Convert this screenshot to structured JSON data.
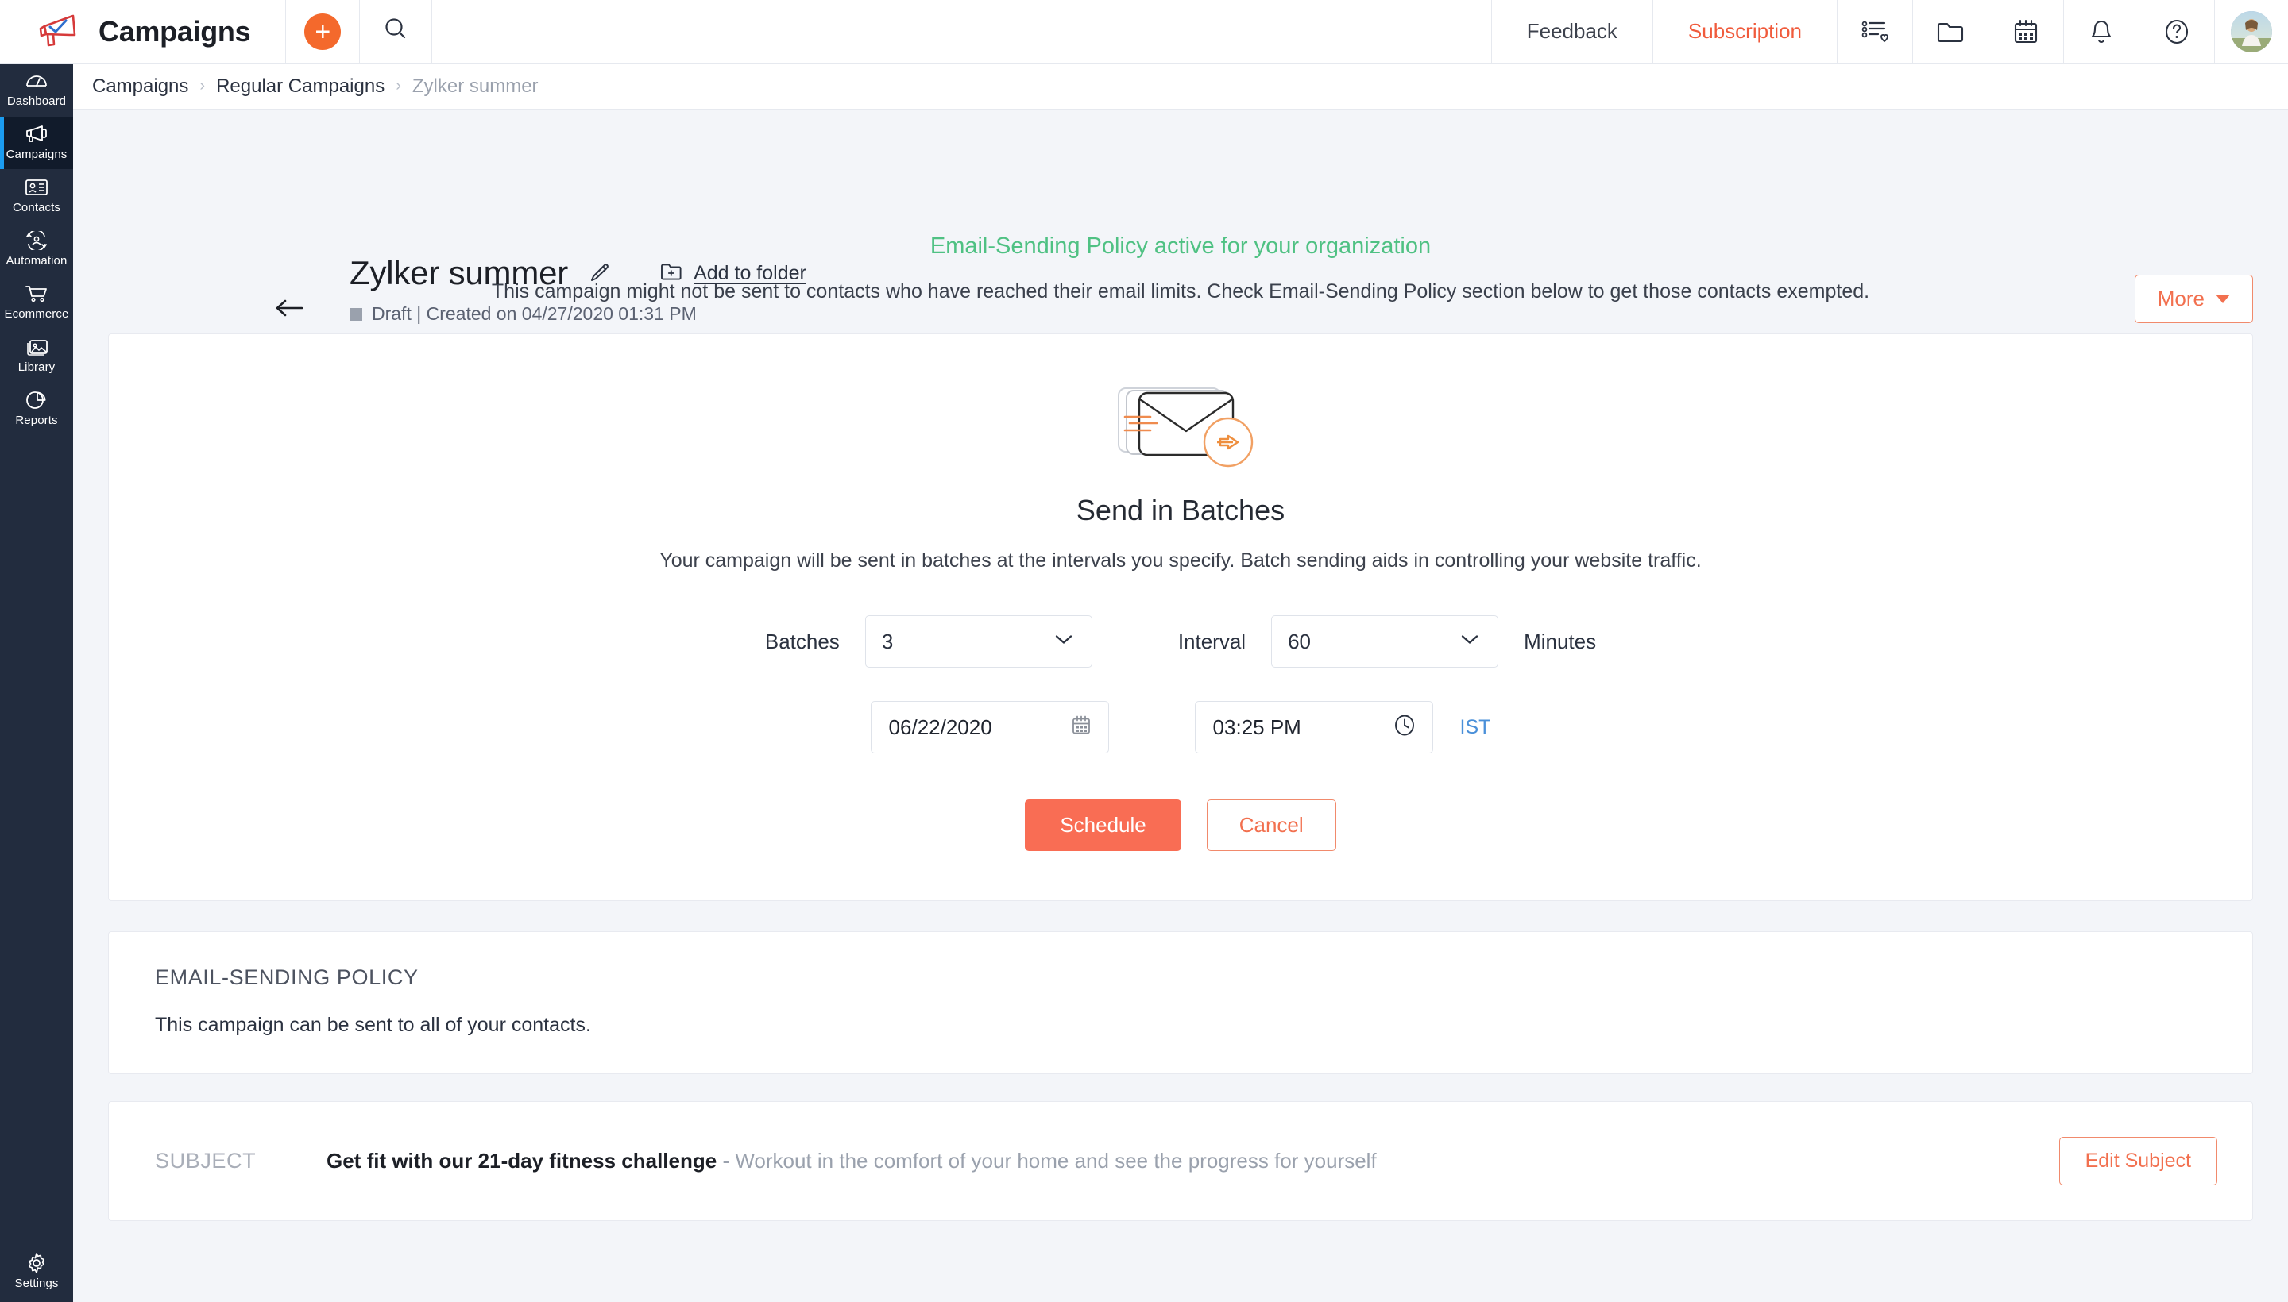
{
  "app": {
    "brand_name": "Campaigns",
    "logo_icon": "megaphone-logo-icon",
    "add_icon": "plus-icon",
    "search_icon": "search-icon"
  },
  "topbar": {
    "feedback_label": "Feedback",
    "subscription_label": "Subscription",
    "subscription_color": "#f05b3c",
    "icons": [
      {
        "name": "list-heart-icon"
      },
      {
        "name": "folder-icon"
      },
      {
        "name": "calendar-icon"
      },
      {
        "name": "bell-icon"
      },
      {
        "name": "help-circle-icon"
      }
    ],
    "avatar_name": "user-avatar"
  },
  "sidebar": {
    "background": "#222c3e",
    "active_accent": "#1b9cf0",
    "items": [
      {
        "label": "Dashboard",
        "icon": "gauge-icon",
        "active": false
      },
      {
        "label": "Campaigns",
        "icon": "megaphone-icon",
        "active": true
      },
      {
        "label": "Contacts",
        "icon": "contact-card-icon",
        "active": false
      },
      {
        "label": "Automation",
        "icon": "automation-users-icon",
        "active": false
      },
      {
        "label": "Ecommerce",
        "icon": "shopping-cart-icon",
        "active": false
      },
      {
        "label": "Library",
        "icon": "image-stack-icon",
        "active": false
      },
      {
        "label": "Reports",
        "icon": "pie-chart-icon",
        "active": false
      }
    ],
    "bottom": {
      "label": "Settings",
      "icon": "gear-icon"
    }
  },
  "breadcrumb": {
    "items": [
      "Campaigns",
      "Regular Campaigns",
      "Zylker summer"
    ],
    "separator": "›"
  },
  "header": {
    "back_icon": "back-arrow-icon",
    "title": "Zylker summer",
    "edit_icon": "pencil-icon",
    "add_to_folder_label": "Add to folder",
    "add_to_folder_icon": "folder-plus-icon",
    "status": "Draft | Created on 04/27/2020 01:31 PM",
    "more_label": "More",
    "more_caret_icon": "chevron-down-icon"
  },
  "notice": {
    "title": "Email-Sending Policy active for your organization",
    "title_color": "#4fc183",
    "body": "This campaign might not be sent to contacts who have reached their email limits. Check Email-Sending Policy section below to get those contacts exempted."
  },
  "batches_card": {
    "illustration_icon": "stacked-envelopes-send-icon",
    "heading": "Send in Batches",
    "description": "Your campaign will be sent in batches at the intervals you specify. Batch sending aids in controlling your website traffic.",
    "batches_label": "Batches",
    "batches_value": "3",
    "interval_label": "Interval",
    "interval_value": "60",
    "interval_unit": "Minutes",
    "date_value": "06/22/2020",
    "date_icon": "calendar-icon",
    "time_value": "03:25 PM",
    "time_icon": "clock-icon",
    "timezone_label": "IST",
    "timezone_color": "#4a90d9",
    "schedule_label": "Schedule",
    "cancel_label": "Cancel",
    "primary_color": "#f96d54"
  },
  "policy_card": {
    "title": "EMAIL-SENDING POLICY",
    "body": "This campaign can be sent to all of your contacts."
  },
  "subject_card": {
    "label": "SUBJECT",
    "headline": "Get fit with our 21-day fitness challenge",
    "preview": " - Workout in the comfort of your home and see the progress for yourself",
    "edit_label": "Edit Subject"
  }
}
